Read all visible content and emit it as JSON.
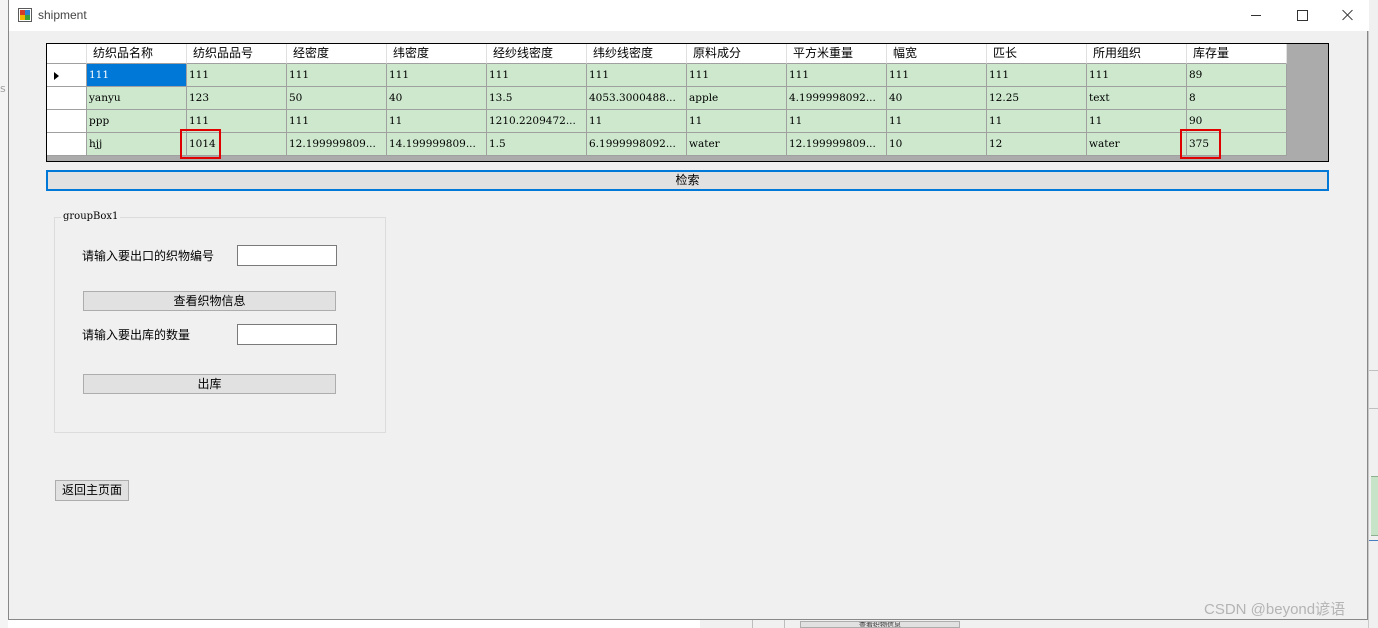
{
  "window": {
    "title": "shipment"
  },
  "grid": {
    "columns": [
      "纺织品名称",
      "纺织品品号",
      "经密度",
      "纬密度",
      "经纱线密度",
      "纬纱线密度",
      "原料成分",
      "平方米重量",
      "幅宽",
      "匹长",
      "所用组织",
      "库存量"
    ],
    "rows": [
      [
        "111",
        "111",
        "111",
        "111",
        "111",
        "111",
        "111",
        "111",
        "111",
        "111",
        "111",
        "89"
      ],
      [
        "yanyu",
        "123",
        "50",
        "40",
        "13.5",
        "4053.3000488...",
        "apple",
        "4.1999998092...",
        "40",
        "12.25",
        "text",
        "8"
      ],
      [
        "ppp",
        "111",
        "111",
        "11",
        "1210.2209472...",
        "11",
        "11",
        "11",
        "11",
        "11",
        "11",
        "90"
      ],
      [
        "hjj",
        "1014",
        "12.199999809...",
        "14.199999809...",
        "1.5",
        "6.1999998092...",
        "water",
        "12.199999809...",
        "10",
        "12",
        "water",
        "375"
      ]
    ],
    "selected_row": 0,
    "selected_cell": "0,0",
    "highlighted_cells": [
      "3,1",
      "3,11"
    ]
  },
  "search_button": "检索",
  "groupbox": {
    "legend": "groupBox1",
    "fabric_id_label": "请输入要出口的织物编号",
    "fabric_id_value": "",
    "view_button": "查看织物信息",
    "quantity_label": "请输入要出库的数量",
    "quantity_value": "",
    "out_button": "出库"
  },
  "back_button": "返回主页面",
  "watermark": "CSDN @beyond谚语",
  "background": {
    "left_fragment": "s",
    "bottom_button": "查看织物信息"
  },
  "colors": {
    "row_background": "#cde8cd",
    "selection": "#0078d7",
    "highlight_box": "#e00000",
    "grid_background": "#ababab"
  }
}
